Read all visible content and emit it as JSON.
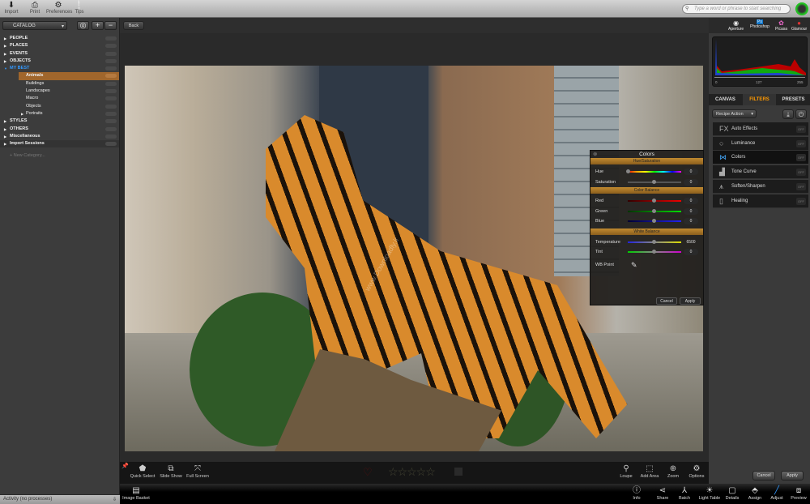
{
  "toolbar": {
    "items": [
      {
        "label": "Import",
        "icon": "import-icon"
      },
      {
        "label": "Print",
        "icon": "print-icon"
      },
      {
        "label": "Preferences",
        "icon": "gear-icon"
      },
      {
        "label": "Tips",
        "icon": "tips-icon"
      }
    ]
  },
  "search": {
    "placeholder": "Type a word or phrase to start searching"
  },
  "sidebar": {
    "catalog_label": "CATALOG",
    "items": [
      {
        "label": "PEOPLE"
      },
      {
        "label": "PLACES"
      },
      {
        "label": "EVENTS"
      },
      {
        "label": "OBJECTS"
      },
      {
        "label": "MY BEST"
      }
    ],
    "sub_items": [
      {
        "label": "Animals"
      },
      {
        "label": "Buildings"
      },
      {
        "label": "Landscapes"
      },
      {
        "label": "Macro"
      },
      {
        "label": "Objects"
      },
      {
        "label": "Portraits"
      }
    ],
    "more_items": [
      {
        "label": "STYLES"
      },
      {
        "label": "OTHERS"
      },
      {
        "label": "Miscellaneous"
      },
      {
        "label": "Import Sessions"
      }
    ],
    "new_category": "+ New Category...",
    "activity": "Activity (no processes)"
  },
  "main": {
    "back_label": "Back",
    "watermark": "www.Downloadly.ir"
  },
  "photo_toolbar": {
    "left": [
      {
        "label": "Quick Select"
      },
      {
        "label": "Slide Show"
      },
      {
        "label": "Full Screen"
      }
    ],
    "right": [
      {
        "label": "Loupe"
      },
      {
        "label": "Add Area"
      },
      {
        "label": "Zoom"
      },
      {
        "label": "Options"
      }
    ],
    "rating_stars": 0
  },
  "bottom_bar": {
    "image_basket": "Image Basket",
    "items": [
      {
        "label": "Info"
      },
      {
        "label": "Share"
      },
      {
        "label": "Batch"
      },
      {
        "label": "Light Table"
      },
      {
        "label": "Details"
      },
      {
        "label": "Assign"
      },
      {
        "label": "Adjust"
      },
      {
        "label": "Preview"
      }
    ]
  },
  "apps": [
    {
      "label": "Aperture"
    },
    {
      "label": "Photoshop"
    },
    {
      "label": "Picasa"
    },
    {
      "label": "Glamour"
    }
  ],
  "histogram": {
    "min": "0",
    "mid": "127",
    "max": "255"
  },
  "tabs": [
    {
      "label": "CANVAS"
    },
    {
      "label": "FILTERS",
      "active": true
    },
    {
      "label": "PRESETS"
    }
  ],
  "recipe_action": "Recipe Action",
  "filters": [
    {
      "label": "Auto Effects",
      "state": "OFF"
    },
    {
      "label": "Luminance",
      "state": "OFF"
    },
    {
      "label": "Colors",
      "state": "OFF"
    },
    {
      "label": "Tone Curve",
      "state": "OFF"
    },
    {
      "label": "Soften/Sharpen",
      "state": "OFF"
    },
    {
      "label": "Healing",
      "state": "OFF"
    }
  ],
  "right_buttons": {
    "cancel": "Cancel",
    "apply": "Apply"
  },
  "colors_dialog": {
    "title": "Colors",
    "sections": {
      "hue_sat": "Hue/Saturation",
      "color_balance": "Color Balance",
      "white_balance": "White Balance"
    },
    "hue": {
      "label": "Hue",
      "value": "0"
    },
    "saturation": {
      "label": "Saturation",
      "value": "0"
    },
    "red": {
      "label": "Red",
      "value": "0"
    },
    "green": {
      "label": "Green",
      "value": "0"
    },
    "blue": {
      "label": "Blue",
      "value": "0"
    },
    "temperature": {
      "label": "Temperature",
      "value": "6500"
    },
    "tint": {
      "label": "Tint",
      "value": "0"
    },
    "wb_point": "WB Point",
    "cancel": "Cancel",
    "apply": "Apply"
  },
  "colors": {
    "accent": "#f7931e",
    "selection": "#a0662c"
  }
}
